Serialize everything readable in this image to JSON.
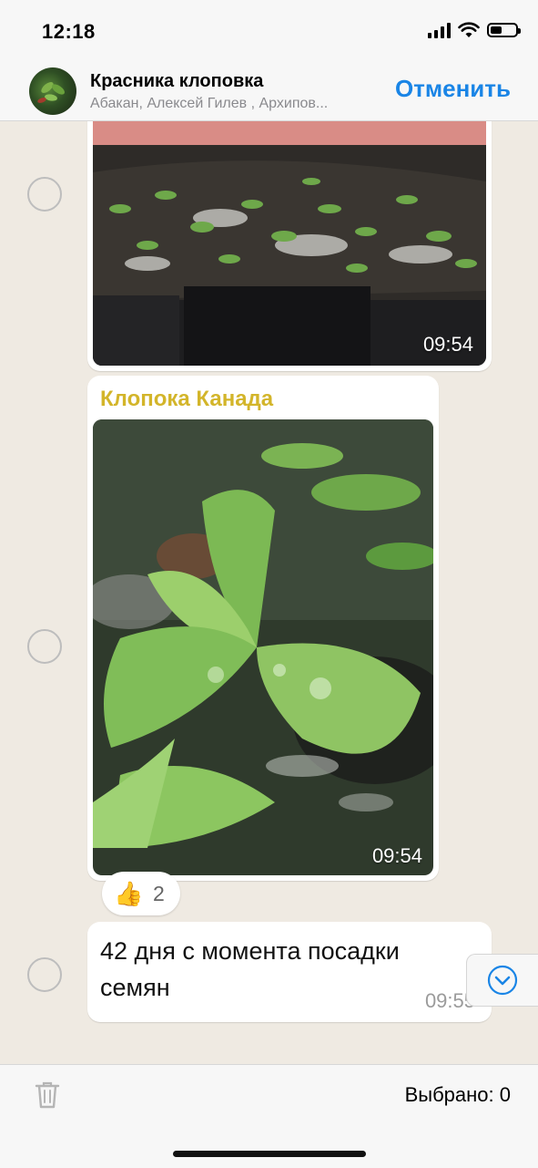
{
  "status_bar": {
    "time": "12:18",
    "battery_level": 0.45
  },
  "header": {
    "title": "Красника клоповка",
    "subtitle": "Абакан, Алексей Гилев , Архипов...",
    "cancel_label": "Отменить"
  },
  "messages": [
    {
      "type": "photo",
      "time": "09:54"
    },
    {
      "type": "photo",
      "sender": "Клопока Канада",
      "time": "09:54"
    },
    {
      "type": "text",
      "text": "42 дня с момента посадки семян",
      "time": "09:55"
    }
  ],
  "reaction": {
    "emoji": "👍",
    "count": "2"
  },
  "footer": {
    "selected_label": "Выбрано: 0"
  },
  "colors": {
    "accent": "#1a85e6",
    "sender_name": "#d3b52a",
    "chat_background": "#efeae2"
  }
}
